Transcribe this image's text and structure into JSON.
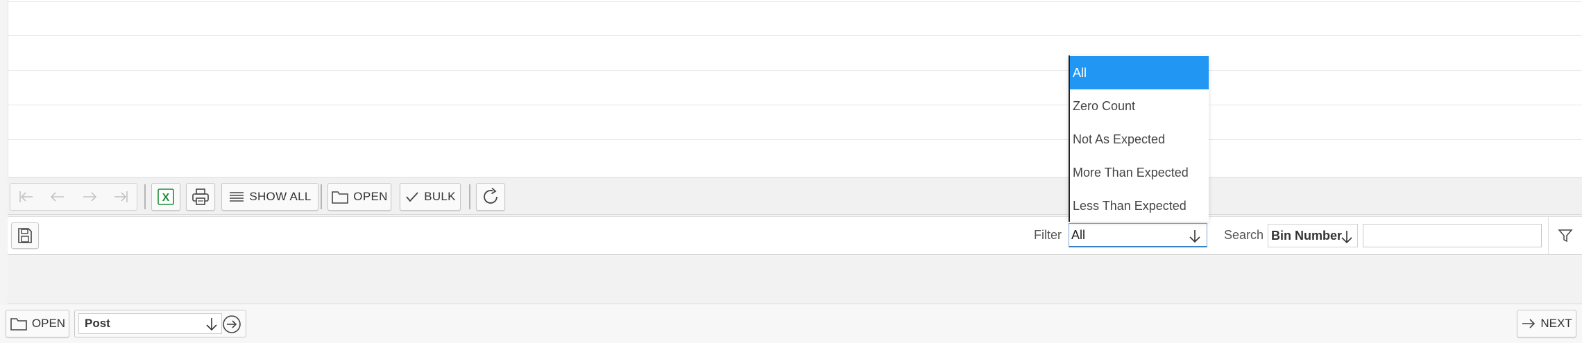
{
  "toolbar": {
    "show_all_label": "SHOW ALL",
    "open_label": "OPEN",
    "bulk_label": "BULK"
  },
  "filterbar": {
    "filter_label": "Filter",
    "filter_value": "All",
    "search_label": "Search",
    "search_field_value": "Bin Number",
    "search_text": ""
  },
  "dropdown": {
    "options": [
      "All",
      "Zero Count",
      "Not As Expected",
      "More Than Expected",
      "Less Than Expected"
    ],
    "selected": "All"
  },
  "bottombar": {
    "open_label": "OPEN",
    "action_value": "Post",
    "next_label": "NEXT"
  },
  "colors": {
    "selected_option_bg": "#2196f3",
    "excel_green": "#1e8f3a"
  }
}
